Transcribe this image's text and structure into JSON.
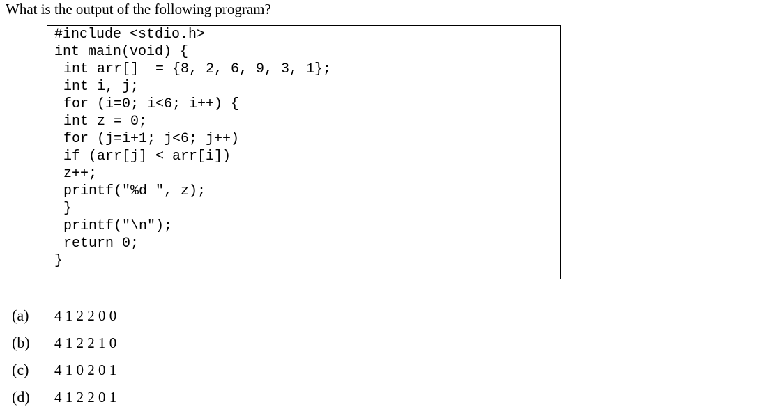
{
  "question": {
    "text": "What is the output of the following program?"
  },
  "code": {
    "lines": [
      "#include <stdio.h>",
      "int main(void) {",
      "int arr[]  = {8, 2, 6, 9, 3, 1};",
      "int i, j;",
      "for (i=0; i<6; i++) {",
      "int z = 0;",
      "for (j=i+1; j<6; j++)",
      "if (arr[j] < arr[i])",
      "z++;",
      "printf(\"%d \", z);",
      "}",
      "printf(\"\\n\");",
      "return 0;",
      "}"
    ]
  },
  "options": [
    {
      "label": "(a)",
      "text": "4 1 2 2 0 0"
    },
    {
      "label": "(b)",
      "text": "4 1 2 2 1 0"
    },
    {
      "label": "(c)",
      "text": "4 1 0 2 0 1"
    },
    {
      "label": "(d)",
      "text": "4 1 2 2 0 1"
    }
  ]
}
